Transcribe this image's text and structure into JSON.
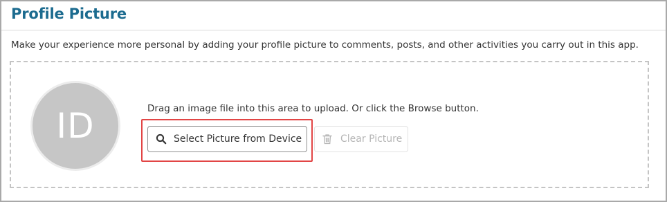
{
  "panel": {
    "title": "Profile Picture",
    "description": "Make your experience more personal by adding your profile picture to comments, posts, and other activities you carry out in this app."
  },
  "dropzone": {
    "avatar_initials": "ID",
    "instructions": "Drag an image file into this area to upload. Or click the Browse button.",
    "select_button_label": "Select Picture from Device",
    "select_button_icon": "search-icon",
    "clear_button_label": "Clear Picture",
    "clear_button_icon": "trash-icon"
  },
  "colors": {
    "title": "#1c6b8f",
    "highlight": "#e24545",
    "avatar_bg": "#c6c6c6",
    "disabled_text": "#b5b5b5"
  }
}
